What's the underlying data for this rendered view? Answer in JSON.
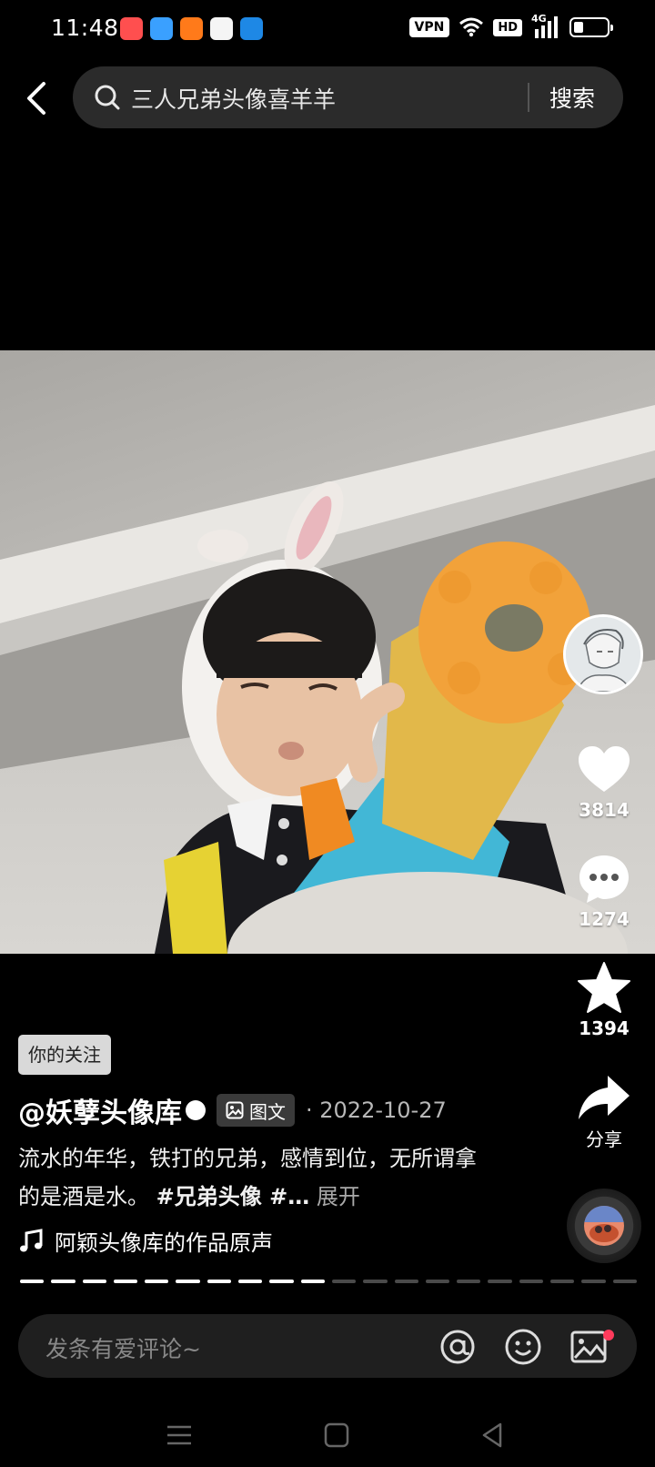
{
  "status_bar": {
    "time": "11:48",
    "vpn": "VPN",
    "hd": "HD",
    "network": "4G",
    "battery_level": 0.3
  },
  "header": {
    "search_query": "三人兄弟头像喜羊羊",
    "search_button": "搜索"
  },
  "actions": {
    "likes": "3814",
    "comments": "1274",
    "favorites": "1394",
    "share_label": "分享"
  },
  "post": {
    "follow_tag": "你的关注",
    "author": "@妖孽头像库",
    "type_badge": "图文",
    "date": "· 2022-10-27",
    "description": "流水的年华，铁打的兄弟，感情到位，无所谓拿的是酒是水。",
    "hashtag": "#兄弟头像 #…",
    "expand": "展开",
    "music": "阿颖头像库的作品原声"
  },
  "progress": {
    "total": 20,
    "current": 10
  },
  "comment_bar": {
    "placeholder": "发条有爱评论~"
  },
  "colors": {
    "accent_red": "#ff3b5c",
    "background": "#000000"
  },
  "icons": [
    "chevron-left-icon",
    "search-icon",
    "heart-icon",
    "comment-icon",
    "star-icon",
    "share-icon",
    "music-note-icon",
    "at-icon",
    "emoji-icon",
    "image-icon"
  ]
}
